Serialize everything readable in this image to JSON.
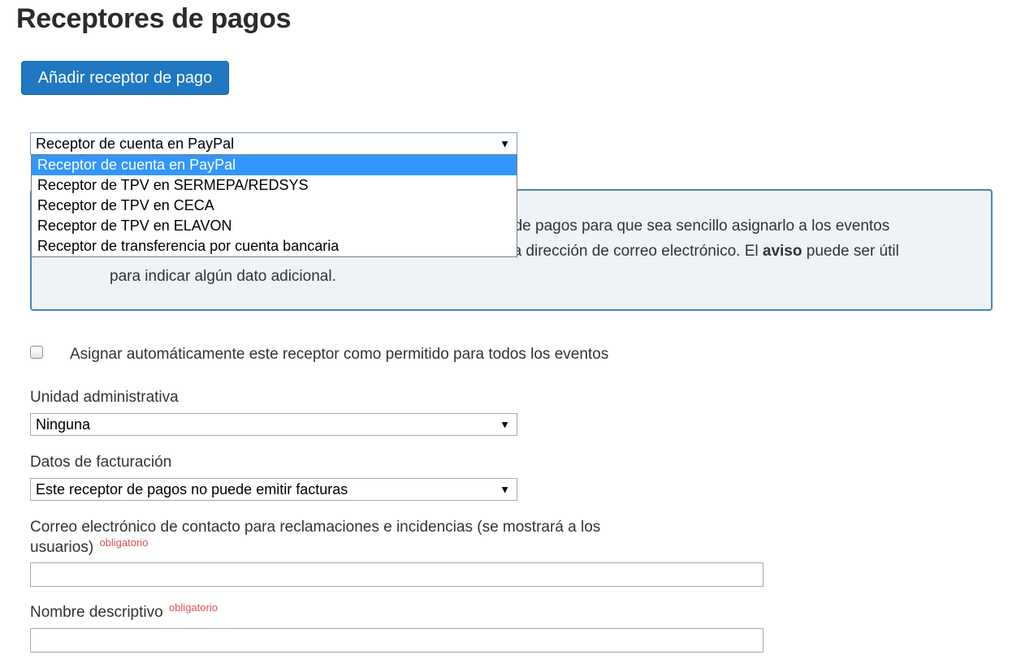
{
  "page": {
    "title": "Receptores de pagos"
  },
  "toolbar": {
    "add_button_label": "Añadir receptor de pago"
  },
  "receiver_type": {
    "selected": "Receptor de cuenta en PayPal",
    "options": [
      "Receptor de cuenta en PayPal",
      "Receptor de TPV en SERMEPA/REDSYS",
      "Receptor de TPV en CECA",
      "Receptor de TPV en ELAVON",
      "Receptor de transferencia por cuenta bancaria"
    ]
  },
  "info": {
    "line1_visible": "r de pagos para que sea sencillo asignarlo a los eventos",
    "line2_visible_before": "na dirección de correo electrónico. El ",
    "line2_bold": "aviso",
    "line2_visible_after": " puede ser útil",
    "line3": "para indicar algún dato adicional."
  },
  "auto_assign": {
    "label": "Asignar automáticamente este receptor como permitido para todos los eventos",
    "checked": false
  },
  "admin_unit": {
    "label": "Unidad administrativa",
    "selected": "Ninguna"
  },
  "billing": {
    "label": "Datos de facturación",
    "selected": "Este receptor de pagos no puede emitir facturas"
  },
  "contact_email": {
    "label_line1": "Correo electrónico de contacto para reclamaciones e incidencias (se mostrará a los",
    "label_line2": "usuarios)",
    "required_label": "obligatorio",
    "value": ""
  },
  "descriptive_name": {
    "label": "Nombre descriptivo",
    "required_label": "obligatorio",
    "value": ""
  },
  "colors": {
    "primary_button": "#1f78c1",
    "info_border": "#4a86b8",
    "info_background": "#eef3f8",
    "dropdown_highlight": "#3396ff",
    "required_text": "#d9534f"
  }
}
